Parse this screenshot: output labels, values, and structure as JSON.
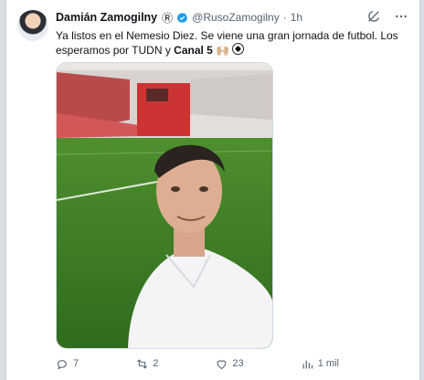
{
  "author": {
    "name": "Damián Zamogilny",
    "badge": "Ⓡ",
    "handle": "@RusoZamogilny",
    "separator": "·",
    "time": "1h",
    "verified_color": "#1d9bf0"
  },
  "tweet": {
    "text_main": "Ya listos en el Nemesio Diez. Se viene una gran jornada de futbol. Los esperamos por TUDN y ",
    "text_bold": "Canal 5",
    "emoji": "🙌🏼"
  },
  "icons": {
    "grok": "grok-icon",
    "more": "more-icon",
    "reply": "reply-icon",
    "retweet": "retweet-icon",
    "like": "heart-icon",
    "views": "views-icon",
    "bookmark": "bookmark-icon",
    "share": "share-icon"
  },
  "stats": {
    "replies": "7",
    "retweets": "2",
    "likes": "23",
    "views": "1 mil"
  }
}
